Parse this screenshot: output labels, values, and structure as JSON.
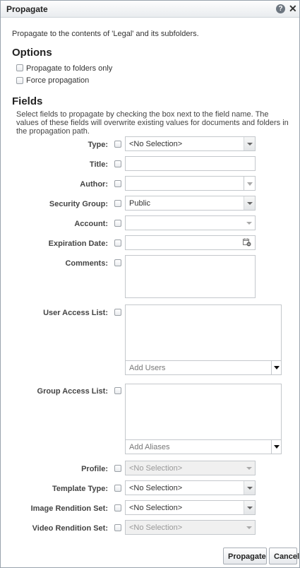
{
  "dialog": {
    "title": "Propagate",
    "help_icon": "help-icon",
    "close_icon": "close-icon",
    "help_glyph": "?",
    "close_glyph": "✕"
  },
  "intro": "Propagate to the contents of 'Legal' and its subfolders.",
  "options": {
    "heading": "Options",
    "folders_only_label": "Propagate to folders only",
    "force_label": "Force propagation"
  },
  "fields": {
    "heading": "Fields",
    "description": "Select fields to propagate by checking the box next to the field name. The values of these fields will overwrite existing values for documents and folders in the propagation path.",
    "type_label": "Type:",
    "type_value": "<No Selection>",
    "title_label": "Title:",
    "title_value": "",
    "author_label": "Author:",
    "author_value": "",
    "security_group_label": "Security Group:",
    "security_group_value": "Public",
    "account_label": "Account:",
    "account_value": "",
    "expiration_label": "Expiration Date:",
    "expiration_value": "",
    "comments_label": "Comments:",
    "comments_value": "",
    "user_access_label": "User Access List:",
    "add_users_placeholder": "Add Users",
    "group_access_label": "Group Access List:",
    "add_aliases_placeholder": "Add Aliases",
    "profile_label": "Profile:",
    "profile_value": "<No Selection>",
    "template_type_label": "Template Type:",
    "template_type_value": "<No Selection>",
    "image_rendition_label": "Image Rendition Set:",
    "image_rendition_value": "<No Selection>",
    "video_rendition_label": "Video Rendition Set:",
    "video_rendition_value": "<No Selection>"
  },
  "buttons": {
    "propagate": "Propagate",
    "cancel": "Cancel"
  }
}
